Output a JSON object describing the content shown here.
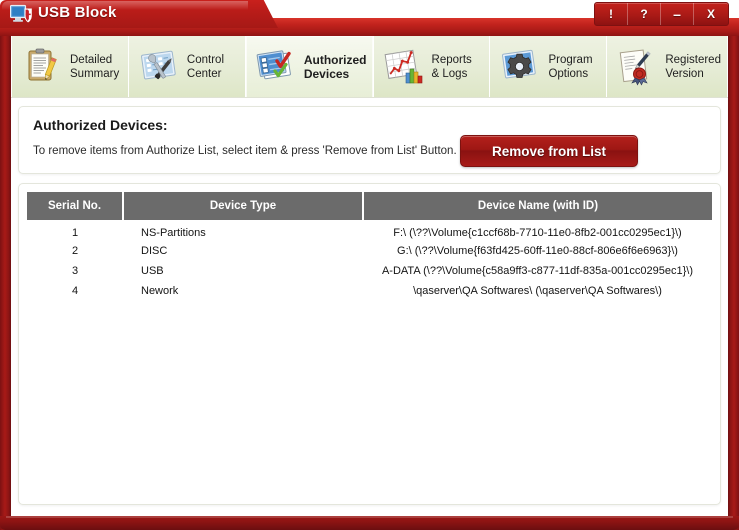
{
  "window": {
    "title": "USB Block",
    "logo_icon": "monitor-shield-icon",
    "controls": [
      {
        "name": "info-button",
        "glyph": "!"
      },
      {
        "name": "help-button",
        "glyph": "?"
      },
      {
        "name": "minimize-button",
        "glyph": "–"
      },
      {
        "name": "close-button",
        "glyph": "X"
      }
    ]
  },
  "colors": {
    "titlebar_red": "#b91c19",
    "frame_red": "#8d1514",
    "button_red": "#9e1714",
    "tab_green": "#e6ecd6",
    "table_header_gray": "#6b6b6b"
  },
  "tabs": [
    {
      "label": "Detailed\nSummary",
      "icon": "clipboard-pencil-icon",
      "active": false
    },
    {
      "label": "Control\nCenter",
      "icon": "screen-tools-icon",
      "active": false
    },
    {
      "label": "Authorized\nDevices",
      "icon": "checklist-checks-icon",
      "active": true
    },
    {
      "label": "Reports\n& Logs",
      "icon": "chart-graph-icon",
      "active": false
    },
    {
      "label": "Program\nOptions",
      "icon": "screen-gear-icon",
      "active": false
    },
    {
      "label": "Registered\nVersion",
      "icon": "certificate-seal-icon",
      "active": false
    }
  ],
  "info": {
    "title": "Authorized Devices:",
    "subtitle": "To remove items from Authorize List, select item & press 'Remove from List' Button.",
    "remove_button": "Remove from List"
  },
  "table": {
    "headers": [
      "Serial No.",
      "Device Type",
      "Device Name (with ID)"
    ],
    "rows": [
      {
        "serial": "1",
        "type": "NS-Partitions",
        "name": "F:\\ (\\??\\Volume{c1ccf68b-7710-11e0-8fb2-001cc0295ec1}\\)"
      },
      {
        "serial": "2",
        "type": "DISC",
        "name": "G:\\ (\\??\\Volume{f63fd425-60ff-11e0-88cf-806e6f6e6963}\\)"
      },
      {
        "serial": "3",
        "type": "USB",
        "name": "A-DATA (\\??\\Volume{c58a9ff3-c877-11df-835a-001cc0295ec1}\\)"
      },
      {
        "serial": "4",
        "type": "Nework",
        "name": "\\qaserver\\QA Softwares\\ (\\qaserver\\QA Softwares\\)"
      }
    ]
  }
}
